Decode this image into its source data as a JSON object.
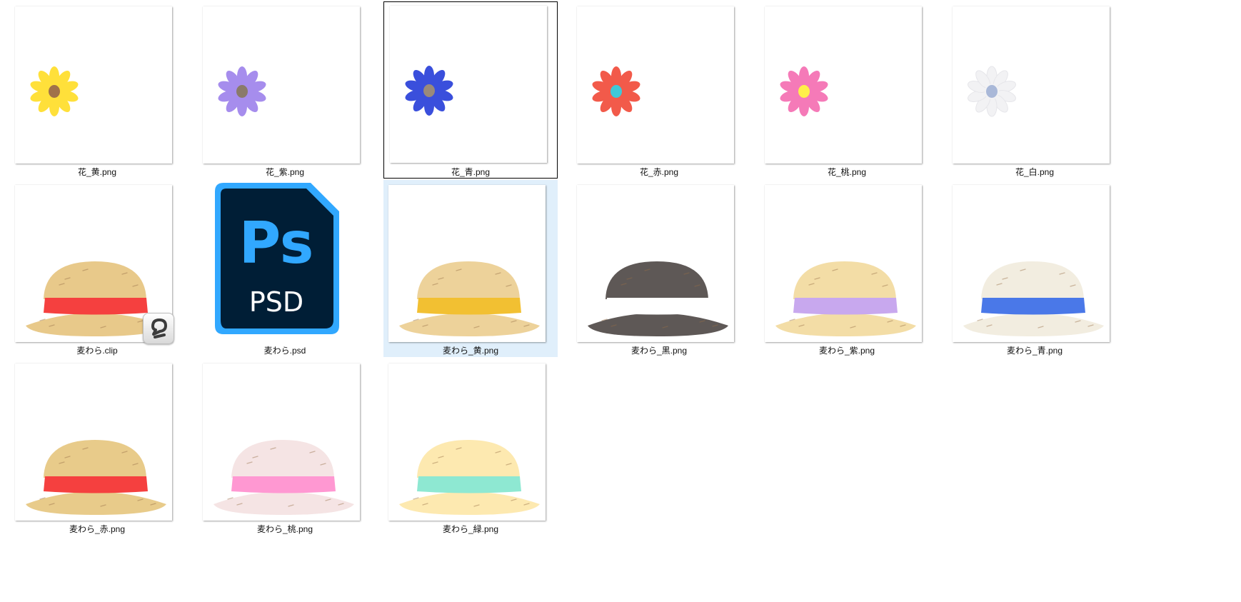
{
  "files": [
    {
      "name": "花_黄.png",
      "kind": "flower",
      "petal": "#ffe03a",
      "center": "#a0724a"
    },
    {
      "name": "花_紫.png",
      "kind": "flower",
      "petal": "#a68ded",
      "center": "#8a7a6a"
    },
    {
      "name": "花_青.png",
      "kind": "flower",
      "petal": "#3a4fdc",
      "center": "#9a8a7a",
      "focused": true
    },
    {
      "name": "花_赤.png",
      "kind": "flower",
      "petal": "#f25a4a",
      "center": "#3fc8d8"
    },
    {
      "name": "花_桃.png",
      "kind": "flower",
      "petal": "#f57ab8",
      "center": "#fff04a"
    },
    {
      "name": "花_白.png",
      "kind": "flower",
      "petal": "#f2f2f4",
      "center": "#a9b8d8"
    },
    {
      "name": "麦わら.clip",
      "kind": "hat",
      "crown": "#e8c98a",
      "brim": "#e8c98a",
      "band": "#f5403f",
      "badge": "clip-studio-icon"
    },
    {
      "name": "麦わら.psd",
      "kind": "psd",
      "psText": "Ps",
      "psdText": "PSD"
    },
    {
      "name": "麦わら_黄.png",
      "kind": "hat",
      "crown": "#edd29a",
      "brim": "#edd29a",
      "band": "#f2c032",
      "selected": true
    },
    {
      "name": "麦わら_黒.png",
      "kind": "hat",
      "crown": "#5e5856",
      "brim": "#5e5856",
      "band": "#ffffff"
    },
    {
      "name": "麦わら_紫.png",
      "kind": "hat",
      "crown": "#f3dda6",
      "brim": "#f3dda6",
      "band": "#c8a8ee"
    },
    {
      "name": "麦わら_青.png",
      "kind": "hat",
      "crown": "#f2ede0",
      "brim": "#f2ede0",
      "band": "#4a78e8"
    },
    {
      "name": "麦わら_赤.png",
      "kind": "hat",
      "crown": "#e8cb8a",
      "brim": "#e8cb8a",
      "band": "#f5403f"
    },
    {
      "name": "麦わら_桃.png",
      "kind": "hat",
      "crown": "#f5e4e4",
      "brim": "#f5e4e4",
      "band": "#ff98d2"
    },
    {
      "name": "麦わら_緑.png",
      "kind": "hat",
      "crown": "#fde9b0",
      "brim": "#fde9b0",
      "band": "#8ee8d2"
    }
  ]
}
